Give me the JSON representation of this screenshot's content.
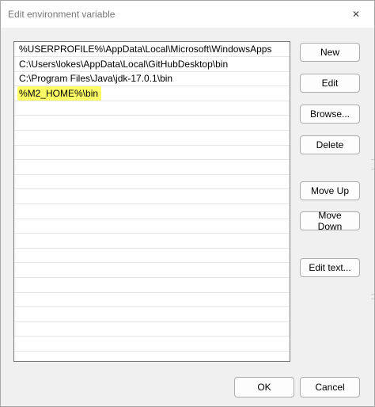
{
  "window": {
    "title": "Edit environment variable",
    "close_glyph": "✕"
  },
  "list": {
    "items": [
      {
        "text": "%USERPROFILE%\\AppData\\Local\\Microsoft\\WindowsApps"
      },
      {
        "text": "C:\\Users\\lokes\\AppData\\Local\\GitHubDesktop\\bin"
      },
      {
        "text": "C:\\Program Files\\Java\\jdk-17.0.1\\bin"
      },
      {
        "text": "%M2_HOME%\\bin",
        "selected": true
      }
    ],
    "highlight_color": "#ffff66"
  },
  "buttons": {
    "new": "New",
    "edit": "Edit",
    "browse": "Browse...",
    "delete": "Delete",
    "move_up": "Move Up",
    "move_down": "Move Down",
    "edit_text": "Edit text...",
    "ok": "OK",
    "cancel": "Cancel"
  }
}
